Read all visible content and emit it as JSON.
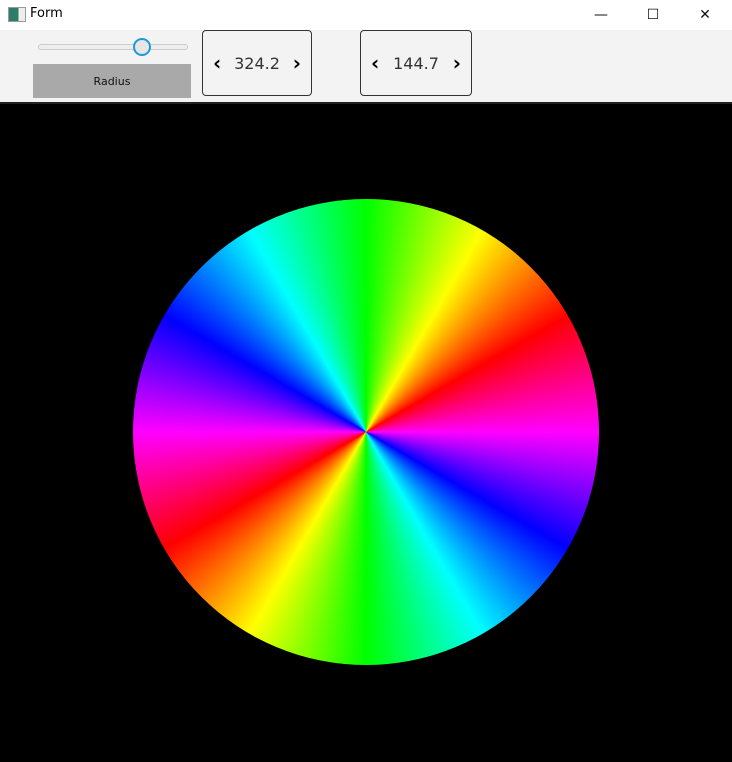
{
  "window": {
    "title": "Form",
    "minimize": "—",
    "maximize": "☐",
    "close": "✕"
  },
  "toolbar": {
    "slider": {
      "value_fraction": 0.7,
      "accent": "#1e9ad6"
    },
    "radius_label": "Radius",
    "spinner1": {
      "value": "324.2",
      "prev": "‹",
      "next": "›"
    },
    "spinner2": {
      "value": "144.7",
      "prev": "‹",
      "next": "›"
    }
  },
  "canvas": {
    "background": "#000000",
    "drawing": "rainbow-radial-line-wheel"
  }
}
